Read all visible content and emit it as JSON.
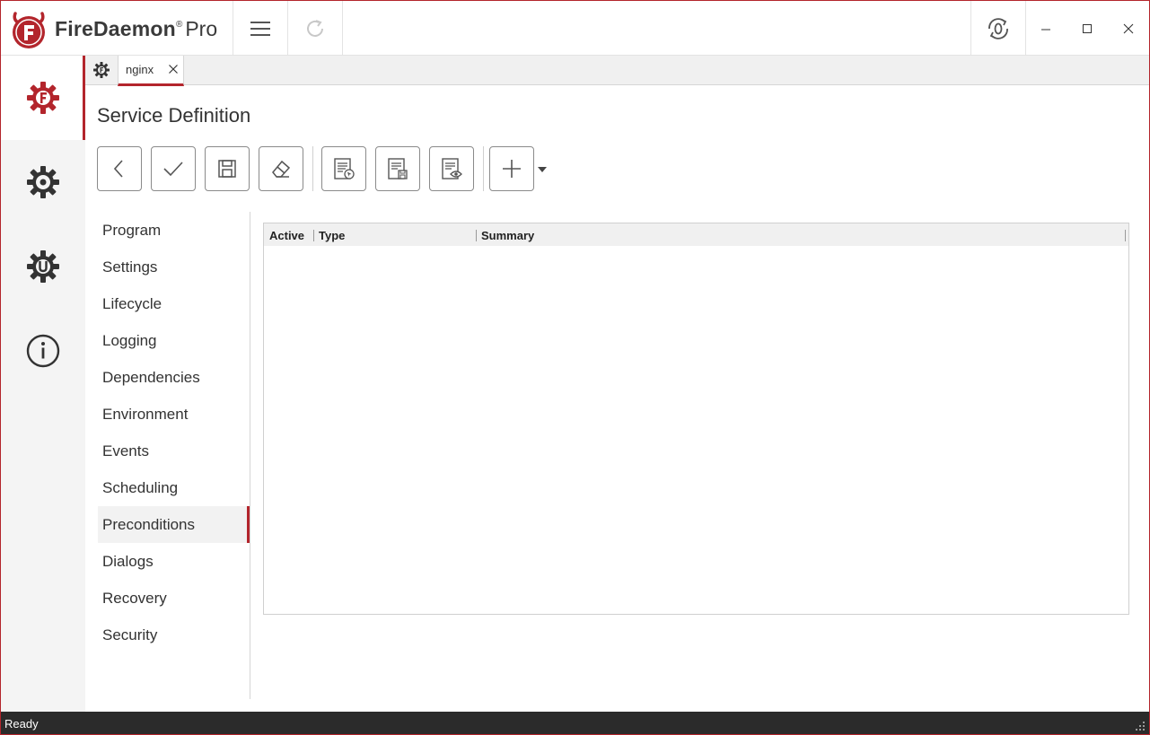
{
  "app": {
    "brand_bold": "FireDaemon",
    "brand_reg": "®",
    "brand_suffix": "Pro"
  },
  "titlebar": {
    "icons": [
      "hamburger-menu-icon",
      "refresh-icon",
      "timer-reset-icon",
      "minimize-icon",
      "maximize-icon",
      "close-icon"
    ]
  },
  "rail": {
    "items": [
      {
        "icon": "firedaemon-services-icon",
        "active": true
      },
      {
        "icon": "gear-settings-icon"
      },
      {
        "icon": "update-gear-icon"
      },
      {
        "icon": "info-icon"
      }
    ]
  },
  "tabs": [
    {
      "label": "nginx"
    }
  ],
  "page": {
    "title": "Service Definition"
  },
  "toolbar": {
    "buttons": [
      "back-icon",
      "check-icon",
      "save-icon",
      "eraser-icon",
      "document-cursor-icon",
      "document-save-icon",
      "document-preview-icon",
      "plus-icon"
    ]
  },
  "nav": {
    "items": [
      "Program",
      "Settings",
      "Lifecycle",
      "Logging",
      "Dependencies",
      "Environment",
      "Events",
      "Scheduling",
      "Preconditions",
      "Dialogs",
      "Recovery",
      "Security"
    ],
    "selected": "Preconditions"
  },
  "grid": {
    "columns": [
      "Active",
      "Type",
      "Summary"
    ],
    "rows": []
  },
  "status": {
    "text": "Ready"
  },
  "colors": {
    "accent": "#b3252c",
    "statusbar": "#2b2b2b",
    "rail": "#f4f4f4"
  }
}
